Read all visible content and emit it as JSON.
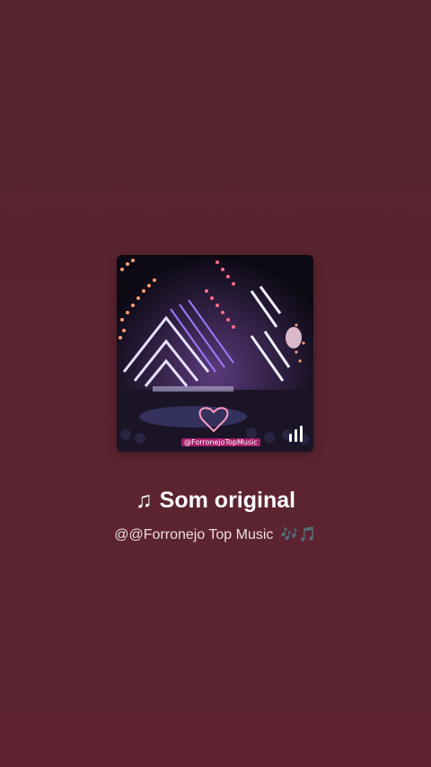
{
  "sound": {
    "cover_alt": "Concert stage with pink and purple lights",
    "watermark": "@ForronejoTopMusic",
    "title_icon": "♫",
    "title": "Som original",
    "author": "@@Forronejo Top Music",
    "author_emoji": "🎶🎵"
  },
  "colors": {
    "background": "#5a2430",
    "stage_pink": "#ff8aa0",
    "stage_purple": "#8a5cff"
  },
  "icons": {
    "title_icon": "music-note-icon",
    "cover_overlay": "equalizer-bars-icon",
    "heart": "heart-outline-icon"
  }
}
